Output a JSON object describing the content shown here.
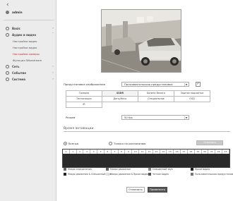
{
  "sidebar": {
    "back_icon": "chevron-left-icon",
    "user": {
      "name": "admin",
      "icon": "user-icon"
    },
    "menu": [
      {
        "label": "Basic",
        "type": "parent"
      },
      {
        "label": "Аудио и видео",
        "type": "parent"
      },
      {
        "label": "Настройка видео",
        "type": "child"
      },
      {
        "label": "Настройка видео",
        "type": "child"
      },
      {
        "label": "Настройка камеры",
        "type": "child",
        "active": true
      },
      {
        "label": "Функция Wisestream",
        "type": "child"
      },
      {
        "label": "Сеть",
        "type": "parent"
      },
      {
        "label": "Событие",
        "type": "parent"
      },
      {
        "label": "Система",
        "type": "parent"
      }
    ]
  },
  "camera": {
    "profile_label": "Предустановка изображения",
    "profile_value": "Пользовательская предустановка",
    "profile_checked": true,
    "tabs_row1": [
      "Галерея",
      "SSDR",
      "Баланс белого",
      "Задняя подсветка"
    ],
    "tabs_row2": [
      "Экспозиция",
      "День/Ночь",
      "Специальное",
      "OSD"
    ],
    "tabs_row3": [
      "IR"
    ],
    "active_tab": "SSDR",
    "mode_label": "Режим",
    "mode_value": "50 fps"
  },
  "schedule": {
    "title": "Время активации",
    "radio_always": "Всегда",
    "radio_schedule": "Только по расписанию",
    "always_selected": true,
    "clear_label": "Отменить",
    "hours": [
      "0",
      "1",
      "2",
      "3",
      "4",
      "5",
      "6",
      "7",
      "8",
      "9",
      "10",
      "11",
      "12",
      "13",
      "14",
      "15",
      "16",
      "17",
      "18",
      "19",
      "20",
      "21",
      "22",
      "23"
    ]
  },
  "legend": {
    "row1": [
      {
        "label": "Макро определения",
        "color": "#666666"
      },
      {
        "label": "Макро движения",
        "color": "#666666"
      },
      {
        "label": "Смешанный звук",
        "color": "#888888"
      },
      {
        "label": "Яркое видео",
        "color": "#222222"
      }
    ],
    "row2": [
      {
        "label": "Макро движения & Смешанный звук",
        "color": "#222222"
      },
      {
        "label": "Макро движения & Яркое видео",
        "color": "#dddddd"
      },
      {
        "label": "Четкое видео",
        "color": "#555555"
      },
      {
        "label": "Пользовательская предустановка",
        "color": "#777777"
      }
    ]
  },
  "footer": {
    "cancel_label": "Отменить",
    "apply_label": "Применить"
  }
}
